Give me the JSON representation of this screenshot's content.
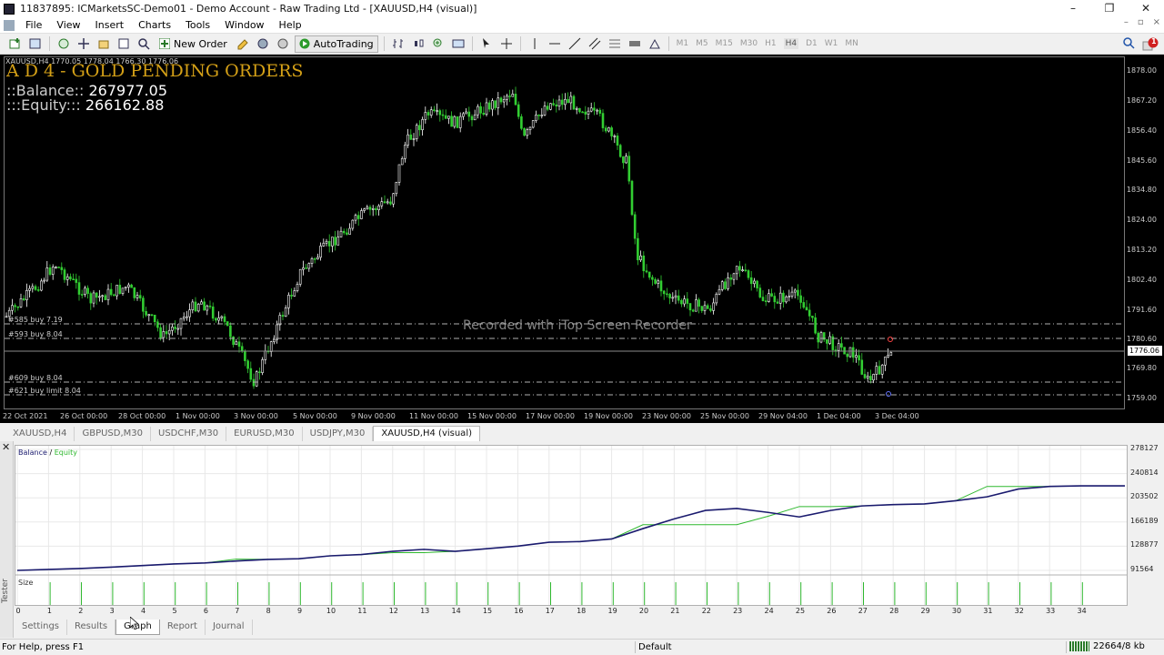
{
  "window": {
    "title": "11837895: ICMarketsSC-Demo01 - Demo Account - Raw Trading Ltd - [XAUUSD,H4 (visual)]",
    "controls": [
      "–",
      "❐",
      "✕"
    ]
  },
  "menu": {
    "items": [
      "File",
      "View",
      "Insert",
      "Charts",
      "Tools",
      "Window",
      "Help"
    ],
    "mdi_controls": [
      "–",
      "▫",
      "×"
    ]
  },
  "toolbar": {
    "new_order_label": "New Order",
    "autotrading_label": "AutoTrading",
    "timeframes": [
      "M1",
      "M5",
      "M15",
      "M30",
      "H1",
      "H4",
      "D1",
      "W1",
      "MN"
    ],
    "active_timeframe": "H4",
    "notification_count": "1"
  },
  "chart": {
    "symbol_line": "XAUUSD,H4  1770.05 1778.04 1766.30 1776.06",
    "ea_title": "A D 4 - GOLD PENDING ORDERS",
    "balance_label": "::Balance::",
    "balance_value": "267977.05",
    "equity_label": ":::Equity:::",
    "equity_value": "266162.88",
    "orders": [
      "#585 buy 7.19",
      "#593 buy 8.04",
      "#609 buy 8.04",
      "#621 buy limit 8.04"
    ],
    "watermark": "Recorded with iTop Screen Recorder",
    "current_price": "1776.06",
    "price_ticks": [
      "1878.00",
      "1867.20",
      "1856.40",
      "1845.60",
      "1834.80",
      "1824.00",
      "1813.20",
      "1802.40",
      "1791.60",
      "1780.60",
      "1769.80",
      "1759.00"
    ],
    "date_ticks": [
      "22 Oct 2021",
      "26 Oct 00:00",
      "28 Oct 00:00",
      "1 Nov 00:00",
      "3 Nov 00:00",
      "5 Nov 00:00",
      "9 Nov 00:00",
      "11 Nov 00:00",
      "15 Nov 00:00",
      "17 Nov 00:00",
      "19 Nov 00:00",
      "23 Nov 00:00",
      "25 Nov 00:00",
      "29 Nov 04:00",
      "1 Dec 04:00",
      "3 Dec 04:00"
    ],
    "colors": {
      "up": "#ffffff",
      "down": "#32cd32",
      "levels": "#b0b0b0"
    }
  },
  "chart_tabs": {
    "items": [
      "XAUUSD,H4",
      "GBPUSD,M30",
      "USDCHF,M30",
      "EURUSD,M30",
      "USDJPY,M30",
      "XAUUSD,H4 (visual)"
    ],
    "active_index": 5
  },
  "tester": {
    "side_label": "Tester",
    "close_glyph": "✕",
    "legend_balance": "Balance",
    "legend_sep": "/",
    "legend_equity": "Equity",
    "size_label": "Size",
    "bottom_tabs": [
      "Settings",
      "Results",
      "Graph",
      "Report",
      "Journal"
    ],
    "active_bottom_tab": 2
  },
  "chart_data": {
    "type": "line",
    "series": [
      {
        "name": "Balance",
        "color": "#1a1a6e",
        "values": [
          91564,
          93000,
          94500,
          96500,
          99000,
          101500,
          103000,
          106000,
          108500,
          109500,
          114000,
          116000,
          121000,
          124000,
          121000,
          125000,
          129000,
          135000,
          136000,
          140000,
          156000,
          171000,
          184000,
          187000,
          181000,
          174000,
          184000,
          191000,
          193000,
          194000,
          199000,
          205000,
          217000,
          221000,
          222000,
          222000
        ]
      },
      {
        "name": "Equity",
        "color": "#2eb82e",
        "values": [
          91564,
          93000,
          94500,
          96500,
          99000,
          101500,
          103000,
          109000,
          108500,
          109500,
          114000,
          116000,
          119000,
          119000,
          121000,
          125000,
          129000,
          135000,
          136000,
          140000,
          162000,
          162000,
          162000,
          162000,
          175000,
          190000,
          190000,
          191000,
          193000,
          194000,
          199000,
          221000,
          221000,
          221000,
          222000,
          222000
        ]
      }
    ],
    "x": [
      0,
      1,
      2,
      3,
      4,
      5,
      6,
      7,
      8,
      9,
      10,
      11,
      12,
      13,
      14,
      15,
      16,
      17,
      18,
      19,
      20,
      21,
      22,
      23,
      24,
      25,
      26,
      27,
      28,
      29,
      30,
      31,
      32,
      33,
      34
    ],
    "y_ticks": [
      "278127",
      "240814",
      "203502",
      "166189",
      "128877",
      "91564"
    ],
    "ylim": [
      91564,
      278127
    ],
    "size_bars": [
      0,
      1,
      1,
      1,
      1,
      1,
      1,
      1,
      1,
      1,
      1,
      1,
      1,
      1,
      1,
      1,
      1,
      1,
      1,
      1,
      1,
      1,
      1,
      1,
      1,
      1,
      1,
      1,
      1,
      1,
      1,
      1,
      1,
      1,
      1
    ]
  },
  "statusbar": {
    "help": "For Help, press F1",
    "profile": "Default",
    "traffic": "22664/8 kb"
  }
}
